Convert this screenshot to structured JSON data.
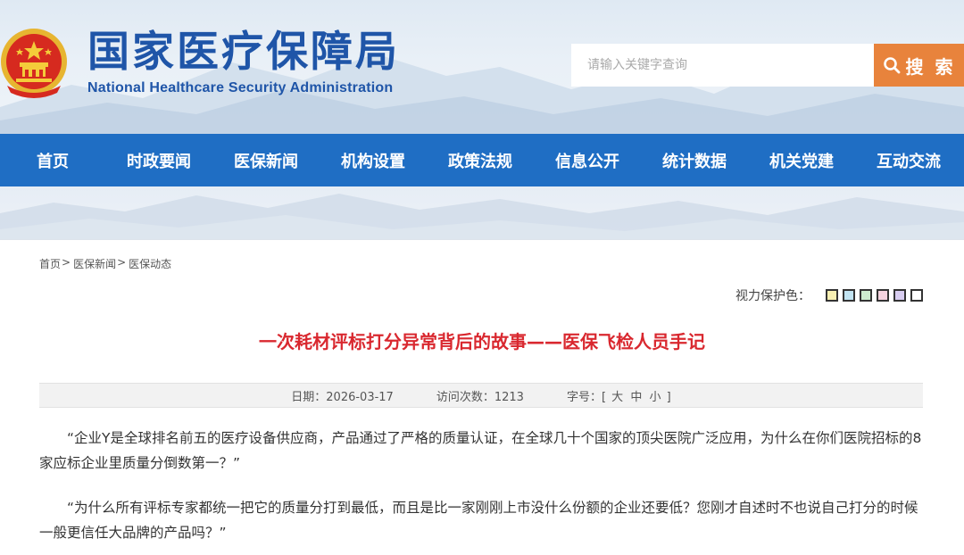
{
  "header": {
    "title": "国家医疗保障局",
    "subtitle": "National Healthcare Security Administration",
    "search_placeholder": "请输入关键字查询",
    "search_label": "搜 索"
  },
  "nav": {
    "items": [
      "首页",
      "时政要闻",
      "医保新闻",
      "机构设置",
      "政策法规",
      "信息公开",
      "统计数据",
      "机关党建",
      "互动交流"
    ]
  },
  "breadcrumb": {
    "items": [
      "首页",
      "医保新闻",
      "医保动态"
    ],
    "separator": ">"
  },
  "eye_care": {
    "label": "视力保护色：",
    "colors": [
      "#f7efb2",
      "#c2e4f2",
      "#cdeccf",
      "#f5d3df",
      "#d8cdf0",
      "#ffffff"
    ]
  },
  "article": {
    "title": "一次耗材评标打分异常背后的故事——医保飞检人员手记",
    "date_label": "日期：",
    "date": "2026-03-17",
    "visits_label": "访问次数：",
    "visits": "1213",
    "font_label": "字号：[",
    "font_large": "大",
    "font_medium": "中",
    "font_small": "小",
    "font_close": "]",
    "paragraphs": [
      "“企业Y是全球排名前五的医疗设备供应商，产品通过了严格的质量认证，在全球几十个国家的顶尖医院广泛应用，为什么在你们医院招标的8家应标企业里质量分倒数第一？”",
      "“为什么所有评标专家都统一把它的质量分打到最低，而且是比一家刚刚上市没什么份额的企业还要低？您刚才自述时不也说自己打分的时候一般更信任大品牌的产品吗？”"
    ]
  },
  "colors": {
    "brand_blue": "#1f55a8",
    "nav_blue": "#1f6ec4",
    "search_orange": "#e8833c",
    "title_red": "#d9282f"
  }
}
